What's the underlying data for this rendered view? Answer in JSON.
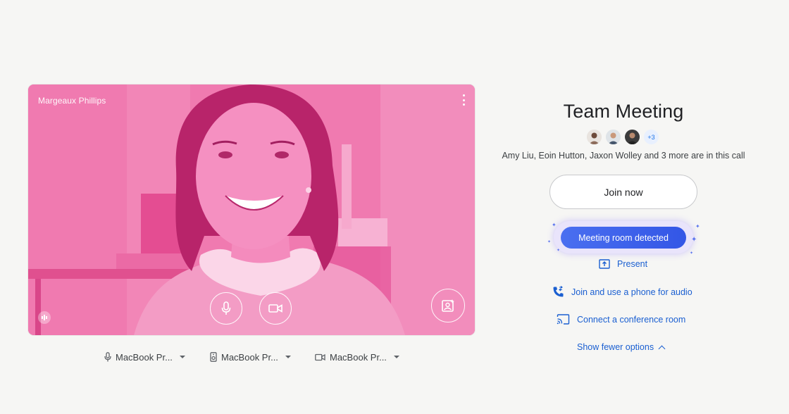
{
  "preview": {
    "participant_name": "Margeaux Phillips"
  },
  "devices": [
    {
      "icon": "microphone-icon",
      "label": "MacBook Pr..."
    },
    {
      "icon": "speaker-icon",
      "label": "MacBook Pr..."
    },
    {
      "icon": "camera-icon",
      "label": "MacBook Pr..."
    }
  ],
  "meeting": {
    "title": "Team Meeting",
    "extra_participants": "+3",
    "in_call_text": "Amy Liu, Eoin Hutton, Jaxon Wolley and 3 more are in this call"
  },
  "actions": {
    "join_now": "Join now",
    "meeting_room_detected": "Meeting room detected",
    "present": "Present",
    "phone_audio": "Join and use a phone for audio",
    "conference_room": "Connect a conference room",
    "show_fewer": "Show fewer options"
  },
  "colors": {
    "preview_tint": "#f07ab0",
    "primary_link": "#1a5fd1",
    "detected_button": "#3f63eb"
  }
}
